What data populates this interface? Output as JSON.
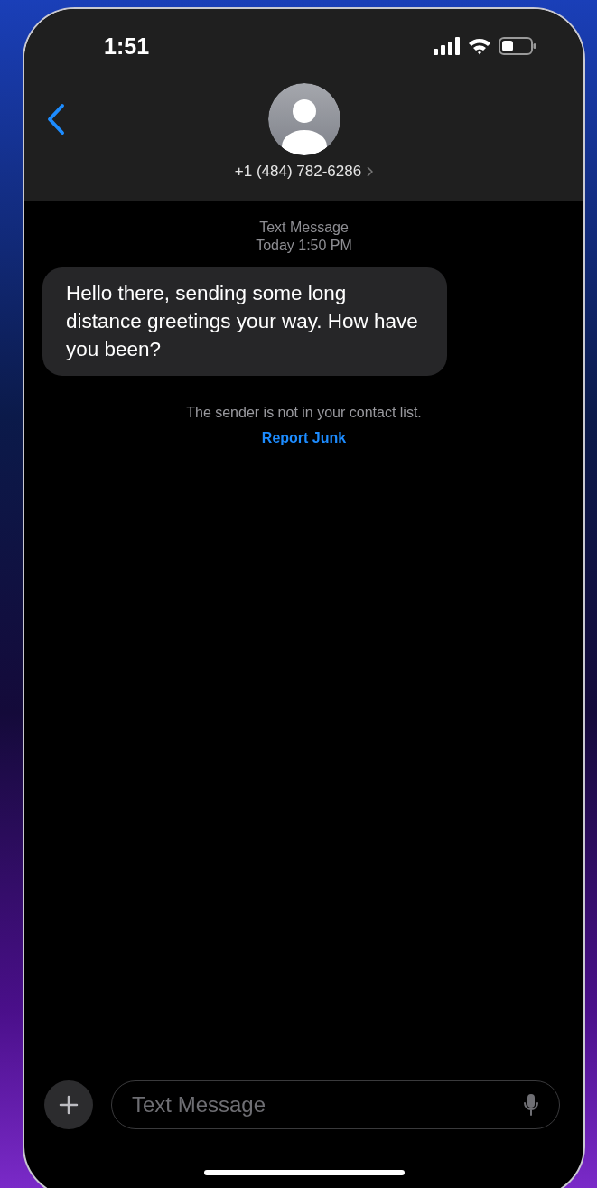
{
  "status_bar": {
    "time": "1:51"
  },
  "header": {
    "contact": "+1 (484) 782-6286"
  },
  "conversation": {
    "service": "Text Message",
    "timestamp": "Today 1:50 PM",
    "messages": [
      {
        "kind": "incoming",
        "text": "Hello there, sending some long distance greetings your way. How have you been?"
      }
    ],
    "notice": "The sender is not in your contact list.",
    "report_link": "Report Junk"
  },
  "composer": {
    "placeholder": "Text Message"
  }
}
